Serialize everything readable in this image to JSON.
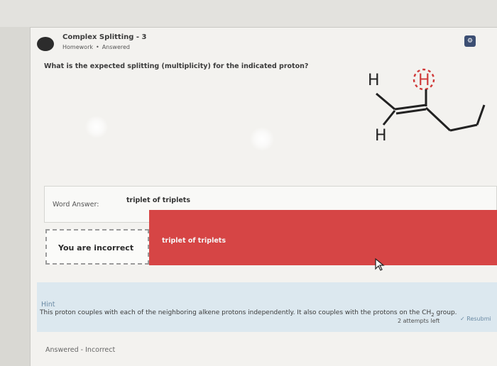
{
  "question": {
    "title": "Complex Splitting - 3",
    "type": "Homework",
    "state": "Answered",
    "prompt": "What is the expected splitting (multiplicity) for the indicated proton?"
  },
  "molecule": {
    "top_left_h": "H",
    "indicated_h": "H",
    "bottom_h": "H"
  },
  "answer": {
    "label": "Word Answer:",
    "value": "triplet of triplets"
  },
  "feedback": {
    "label": "You are incorrect",
    "submitted": "triplet of triplets",
    "color": "#d64545"
  },
  "hint": {
    "title": "Hint",
    "text": "This proton couples with each of the neighboring alkene protons independently. It also couples with the protons on the CH",
    "subscript": "2",
    "text_end": " group."
  },
  "footer": {
    "attempts": "2 attempts left",
    "resubmit": "Resubmi",
    "status": "Answered - Incorrect"
  },
  "icons": {
    "avatar": "avatar-icon",
    "corner": "settings-icon",
    "resubmit": "check-icon",
    "cursor": "mouse-pointer-icon"
  }
}
